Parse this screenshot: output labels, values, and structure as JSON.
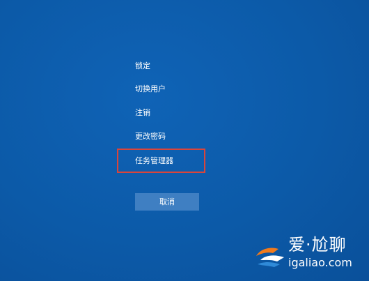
{
  "menu": {
    "items": [
      {
        "label": "锁定"
      },
      {
        "label": "切换用户"
      },
      {
        "label": "注销"
      },
      {
        "label": "更改密码"
      },
      {
        "label": "任务管理器"
      }
    ]
  },
  "cancel_label": "取消",
  "highlight": {
    "color": "#d9453b"
  },
  "colors": {
    "background": "#0c5aa8",
    "button": "#3f7fc2",
    "text": "#ffffff"
  },
  "watermark": {
    "logo": "igaliao-logo",
    "cn": "爱·尬聊",
    "url": "igaliao.com"
  }
}
